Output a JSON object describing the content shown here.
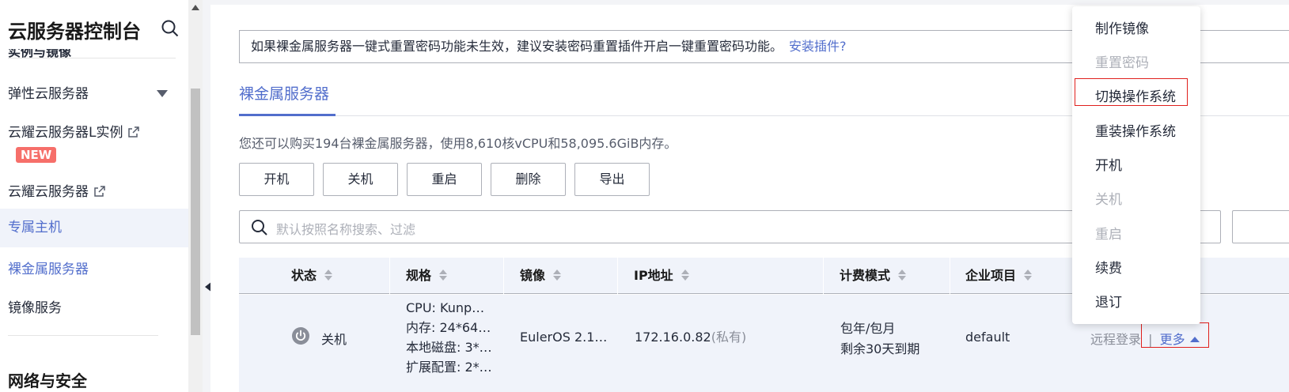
{
  "sidebar": {
    "title": "云服务器控制台",
    "cut_item": "实例与镜像",
    "items": [
      {
        "label": "弹性云服务器"
      },
      {
        "label": "云耀云服务器L实例",
        "badge": "NEW"
      },
      {
        "label": "云耀云服务器"
      },
      {
        "label": "专属主机"
      },
      {
        "label": "裸金属服务器"
      },
      {
        "label": "镜像服务"
      }
    ],
    "group_title": "网络与安全"
  },
  "notice": {
    "text": "如果裸金属服务器一键式重置密码功能未生效，建议安装密码重置插件开启一键重置密码功能。",
    "link": "安装插件?"
  },
  "tab": {
    "label": "裸金属服务器"
  },
  "quota_text": "您还可以购买194台裸金属服务器，使用8,610核vCPU和58,095.6GiB内存。",
  "toolbar": {
    "buttons": [
      "开机",
      "关机",
      "重启",
      "删除",
      "导出"
    ]
  },
  "search": {
    "placeholder": "默认按照名称搜索、过滤"
  },
  "table": {
    "headers": [
      "状态",
      "规格",
      "镜像",
      "IP地址",
      "计费模式",
      "企业项目"
    ],
    "row": {
      "status": "关机",
      "spec": [
        "CPU: Kunp…",
        "内存: 24*64…",
        "本地磁盘: 3*…",
        "扩展配置: 2*…"
      ],
      "image": "EulerOS 2.1…",
      "ip": "172.16.0.82",
      "ip_type": "(私有)",
      "billing": [
        "包年/包月",
        "剩余30天到期"
      ],
      "project": "default",
      "remote_login": "远程登录",
      "separator": "|",
      "more": "更多"
    }
  },
  "menu": {
    "items": [
      {
        "label": "制作镜像",
        "disabled": false
      },
      {
        "label": "重置密码",
        "disabled": true
      },
      {
        "label": "切换操作系统",
        "disabled": false
      },
      {
        "label": "重装操作系统",
        "disabled": false
      },
      {
        "label": "开机",
        "disabled": false
      },
      {
        "label": "关机",
        "disabled": true
      },
      {
        "label": "重启",
        "disabled": true
      },
      {
        "label": "续费",
        "disabled": false
      },
      {
        "label": "退订",
        "disabled": false
      }
    ]
  },
  "colors": {
    "accent": "#526ecc",
    "highlight": "#e0201d",
    "badge": "#f66f6a"
  }
}
